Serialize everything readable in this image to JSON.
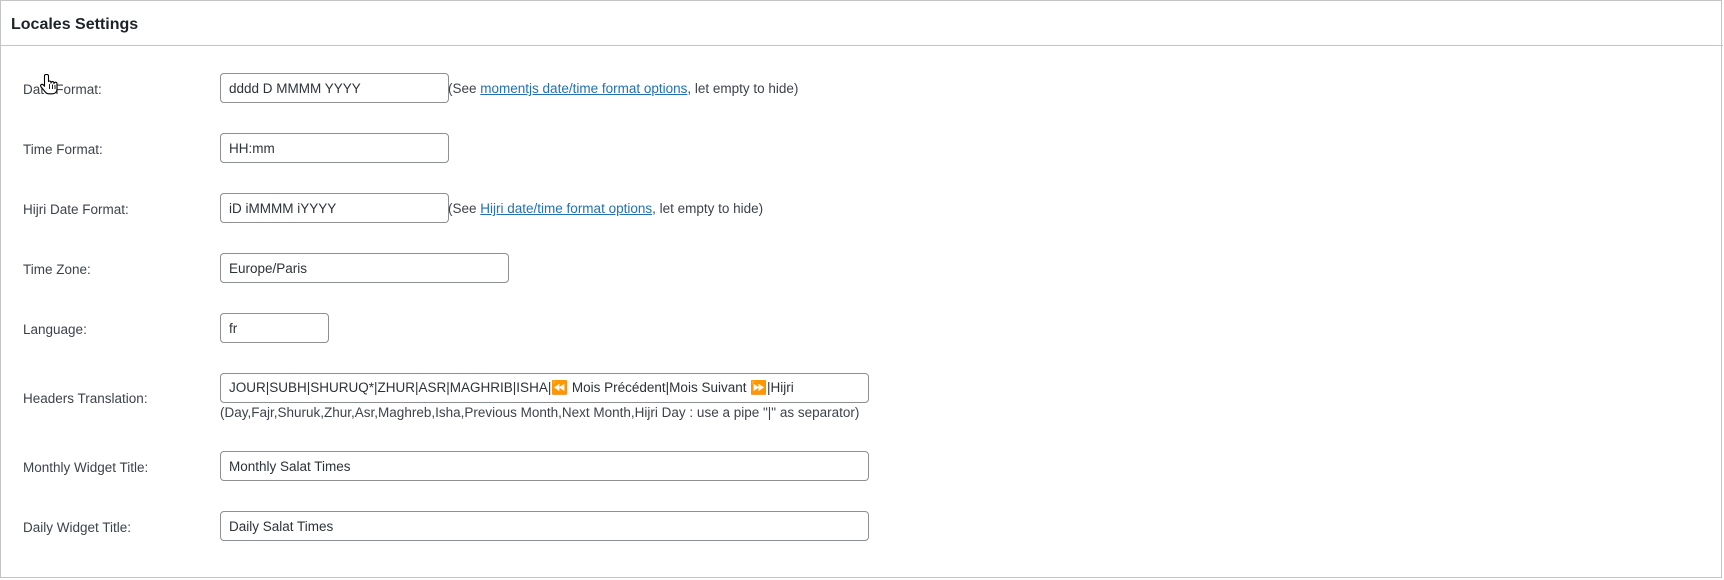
{
  "section": {
    "title": "Locales Settings"
  },
  "fields": {
    "date_format": {
      "label": "Date Format:",
      "value": "dddd D MMMM YYYY",
      "hint_prefix": "(See ",
      "hint_link": "momentjs date/time format options",
      "hint_suffix": ", let empty to hide)"
    },
    "time_format": {
      "label": "Time Format:",
      "value": "HH:mm"
    },
    "hijri_date_format": {
      "label": "Hijri Date Format:",
      "value": "iD iMMMM iYYYY",
      "hint_prefix": "(See ",
      "hint_link": "Hijri date/time format options",
      "hint_suffix": ", let empty to hide)"
    },
    "time_zone": {
      "label": "Time Zone:",
      "value": "Europe/Paris"
    },
    "language": {
      "label": "Language:",
      "value": "fr"
    },
    "headers_translation": {
      "label": "Headers Translation:",
      "value": "JOUR|SUBH|SHURUQ*|ZHUR|ASR|MAGHRIB|ISHA|⏪ Mois Précédent|Mois Suivant ⏩|Hijri",
      "note": "(Day,Fajr,Shuruk,Zhur,Asr,Maghreb,Isha,Previous Month,Next Month,Hijri Day : use a pipe \"|\" as separator)"
    },
    "monthly_widget_title": {
      "label": "Monthly Widget Title:",
      "value": "Monthly Salat Times"
    },
    "daily_widget_title": {
      "label": "Daily Widget Title:",
      "value": "Daily Salat Times"
    }
  },
  "icons": {
    "cursor": "hand-pointer-cursor-icon"
  },
  "colors": {
    "link": "#2271b1",
    "border": "#c3c4c7",
    "input_border": "#8c8f94",
    "text": "#3c434a"
  }
}
